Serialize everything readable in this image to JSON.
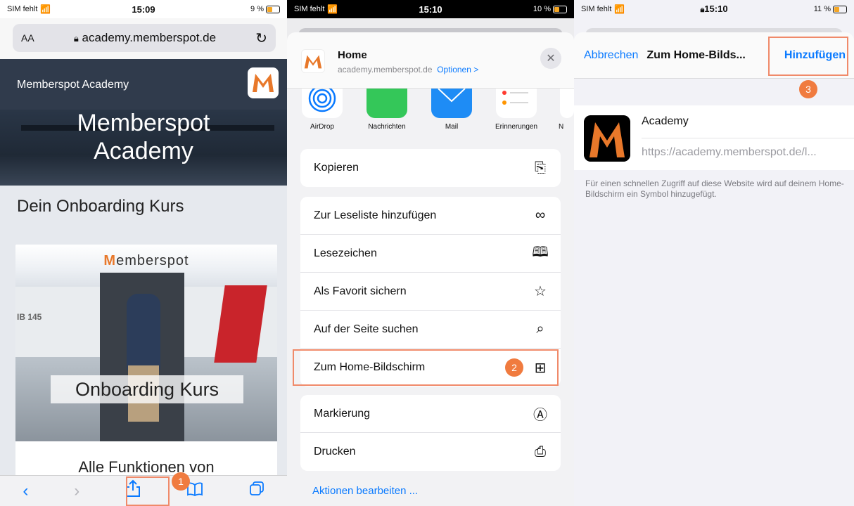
{
  "panel1": {
    "status": {
      "carrier": "SIM fehlt",
      "time": "15:09",
      "battery": "9 %"
    },
    "url_bar": {
      "text_size": "AA",
      "domain": "academy.memberspot.de"
    },
    "hero": {
      "label": "Memberspot Academy",
      "title_line1": "Memberspot",
      "title_line2": "Academy"
    },
    "section_title": "Dein Onboarding Kurs",
    "card": {
      "logo_text_a": "M",
      "logo_text_b": "emberspot",
      "plane_code": "IB 145",
      "badge": "Onboarding Kurs",
      "caption": "Alle Funktionen von"
    },
    "callout": "1"
  },
  "panel2": {
    "status": {
      "carrier": "SIM fehlt",
      "time": "15:10",
      "battery": "10 %"
    },
    "sheet": {
      "title": "Home",
      "subtitle": "academy.memberspot.de",
      "options": "Optionen >"
    },
    "apps": [
      "AirDrop",
      "Nachrichten",
      "Mail",
      "Erinnerungen",
      "N"
    ],
    "group1": [
      "Kopieren"
    ],
    "group2": [
      "Zur Leseliste hinzufügen",
      "Lesezeichen",
      "Als Favorit sichern",
      "Auf der Seite suchen",
      "Zum Home-Bildschirm"
    ],
    "group3": [
      "Markierung",
      "Drucken"
    ],
    "edit_actions": "Aktionen bearbeiten ...",
    "callout": "2"
  },
  "panel3": {
    "status": {
      "carrier": "SIM fehlt",
      "time": "15:10",
      "battery": "11 %"
    },
    "nav": {
      "cancel": "Abbrechen",
      "title": "Zum Home-Bilds...",
      "add": "Hinzufügen"
    },
    "entry": {
      "name": "Academy",
      "url": "https://academy.memberspot.de/l..."
    },
    "note": "Für einen schnellen Zugriff auf diese Website wird auf deinem Home-Bildschirm ein Symbol hinzugefügt.",
    "callout": "3"
  },
  "colors": {
    "accent": "#0a7aff",
    "callout": "#f07b3f",
    "highlight": "#f08a6a",
    "brand_orange": "#e8782a"
  }
}
